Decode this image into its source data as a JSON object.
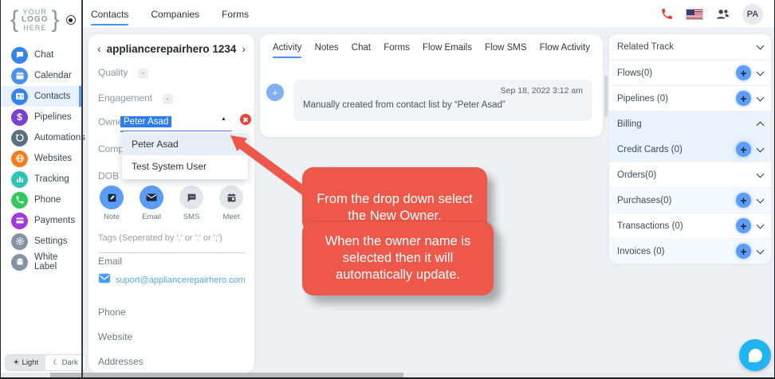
{
  "icons": {
    "plus": "+",
    "caret_up": "▲",
    "prev": "‹",
    "next": "›",
    "sun": "☀",
    "moon": "☾",
    "dollar": "$"
  },
  "colors": {
    "accent_blue": "#4a90f5",
    "selection_blue": "#2e7df0",
    "callout_red": "#ee584a",
    "phone_red": "#e2443b",
    "link_blue": "#58a6f0",
    "chat_widget_blue": "#1fb5f2"
  },
  "topbar": {
    "tabs": [
      {
        "label": "Contacts",
        "active": true
      },
      {
        "label": "Companies",
        "active": false
      },
      {
        "label": "Forms",
        "active": false
      }
    ],
    "avatar": "PA"
  },
  "sidebar": {
    "logo": {
      "line1": "YOUR",
      "line2": "LOGO",
      "line3": "HERE",
      "brace_left": "{",
      "brace_right": "}"
    },
    "items": [
      {
        "label": "Chat",
        "color": "#3585f0"
      },
      {
        "label": "Calendar",
        "color": "#4a90ee"
      },
      {
        "label": "Contacts",
        "color": "#3585f0",
        "active": true
      },
      {
        "label": "Pipelines",
        "color": "#7b3fd4"
      },
      {
        "label": "Automations",
        "color": "#5a7184"
      },
      {
        "label": "Websites",
        "color": "#f07f1e"
      },
      {
        "label": "Tracking",
        "color": "#2ec4b6"
      },
      {
        "label": "Phone",
        "color": "#34c759"
      },
      {
        "label": "Payments",
        "color": "#a238dd"
      },
      {
        "label": "Settings",
        "color": "#8494a4"
      },
      {
        "label": "White Label",
        "color": "#8494a4"
      }
    ],
    "theme": {
      "light": "Light",
      "dark": "Dark"
    }
  },
  "contact": {
    "title": "appliancerepairhero 1234",
    "quality_label": "Quality",
    "quality_value": "-",
    "engagement_label": "Engagement",
    "engagement_value": "-",
    "owner_label": "Owner",
    "owner_value": "Peter Asad",
    "company_label": "Company",
    "dob_label": "DOB",
    "dob_value": "--",
    "dropdown": {
      "options": [
        "Peter Asad",
        "Test System User"
      ],
      "selected": "Peter Asad"
    },
    "actions": [
      {
        "label": "Note"
      },
      {
        "label": "Email"
      },
      {
        "label": "SMS"
      },
      {
        "label": "Meet"
      }
    ],
    "tags_label": "Tags (Seperated by ',' or ':' or ';')",
    "email_label": "Email",
    "email_value": "suport@appliancerepairhero.com",
    "phone_label": "Phone",
    "website_label": "Website",
    "addresses_label": "Addresses"
  },
  "activity": {
    "tabs": [
      {
        "label": "Activity",
        "active": true
      },
      {
        "label": "Notes"
      },
      {
        "label": "Chat"
      },
      {
        "label": "Forms"
      },
      {
        "label": "Flow Emails"
      },
      {
        "label": "Flow SMS"
      },
      {
        "label": "Flow Activity"
      }
    ],
    "entry": {
      "date": "Sep 18, 2022 3:12 am",
      "text": "Manually created from contact list by “Peter Asad”"
    }
  },
  "related": {
    "rows": [
      {
        "label": "Related Track",
        "add": false,
        "expanded": false
      },
      {
        "label": "Flows(0)",
        "add": true,
        "expanded": false
      },
      {
        "label": "Pipelines (0)",
        "add": true,
        "expanded": false
      },
      {
        "label": "Billing",
        "add": false,
        "expanded": true
      },
      {
        "label": "Credit Cards (0)",
        "add": true,
        "expanded": false
      },
      {
        "label": "Orders(0)",
        "add": false,
        "expanded": false
      },
      {
        "label": "Purchases(0)",
        "add": true,
        "expanded": false
      },
      {
        "label": "Transactions (0)",
        "add": true,
        "expanded": false
      },
      {
        "label": "Invoices (0)",
        "add": true,
        "expanded": false
      }
    ]
  },
  "callout": {
    "text1": "From the drop down select the New Owner.",
    "text2": "When the owner name is selected then it will automatically update."
  }
}
